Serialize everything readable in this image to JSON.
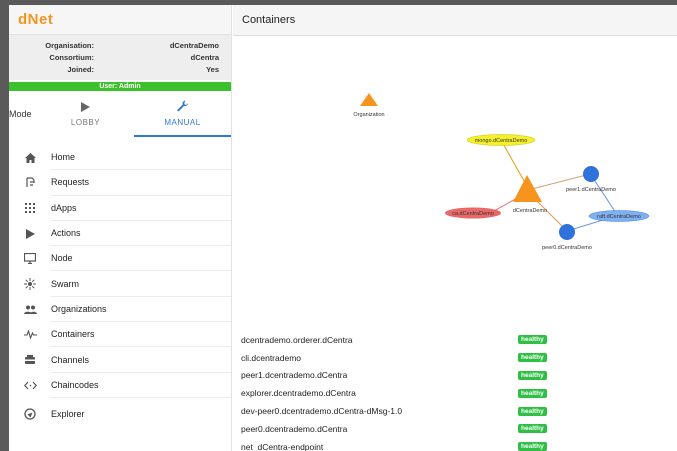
{
  "app": {
    "logo_d": "d",
    "logo_net": "Net",
    "accent": "#f7941d"
  },
  "org_info": [
    {
      "label": "Organisation:",
      "value": "dCentraDemo"
    },
    {
      "label": "Consortium:",
      "value": "dCentra"
    },
    {
      "label": "Joined:",
      "value": "Yes"
    }
  ],
  "user_badge": "User: Admin",
  "mode": {
    "label": "Mode",
    "tabs": [
      {
        "label": "LOBBY",
        "icon": "play-icon"
      },
      {
        "label": "MANUAL",
        "icon": "wrench-icon",
        "active": true
      }
    ]
  },
  "nav": [
    {
      "label": "Home",
      "icon": "home-icon"
    },
    {
      "label": "Requests",
      "icon": "requests-icon"
    },
    {
      "label": "dApps",
      "icon": "apps-grid-icon"
    },
    {
      "label": "Actions",
      "icon": "play-icon"
    },
    {
      "label": "Node",
      "icon": "monitor-icon"
    },
    {
      "label": "Swarm",
      "icon": "swarm-icon"
    },
    {
      "label": "Organizations",
      "icon": "people-icon"
    },
    {
      "label": "Containers",
      "icon": "pulse-icon"
    },
    {
      "label": "Channels",
      "icon": "channels-icon"
    },
    {
      "label": "Chaincodes",
      "icon": "code-icon"
    },
    {
      "label": "Explorer",
      "icon": "explorer-icon"
    }
  ],
  "main": {
    "title": "Containers"
  },
  "graph": {
    "legend_label": "Organization",
    "center_label": "dCentraDemo",
    "nodes": {
      "mongo": "mongo.dCentraDemo",
      "peer1": "peer1.dCentraDemo",
      "ca": "ca.dCentraDemo",
      "raft": "raft.dCentraDemo",
      "peer0": "peer0.dCentraDemo"
    },
    "colors": {
      "org": "#f7941d",
      "mongo": "#f5f02a",
      "peer": "#2f72dc",
      "ca": "#e96868",
      "raft": "#7fb0ef"
    }
  },
  "containers": [
    {
      "name": "dcentrademo.orderer.dCentra",
      "status": "healthy"
    },
    {
      "name": "cli.dcentrademo",
      "status": "healthy"
    },
    {
      "name": "peer1.dcentrademo.dCentra",
      "status": "healthy"
    },
    {
      "name": "explorer.dcentrademo.dCentra",
      "status": "healthy"
    },
    {
      "name": "dev-peer0.dcentrademo.dCentra-dMsg-1.0",
      "status": "healthy"
    },
    {
      "name": "peer0.dcentrademo.dCentra",
      "status": "healthy"
    },
    {
      "name": "net_dCentra-endpoint",
      "status": "healthy"
    }
  ]
}
